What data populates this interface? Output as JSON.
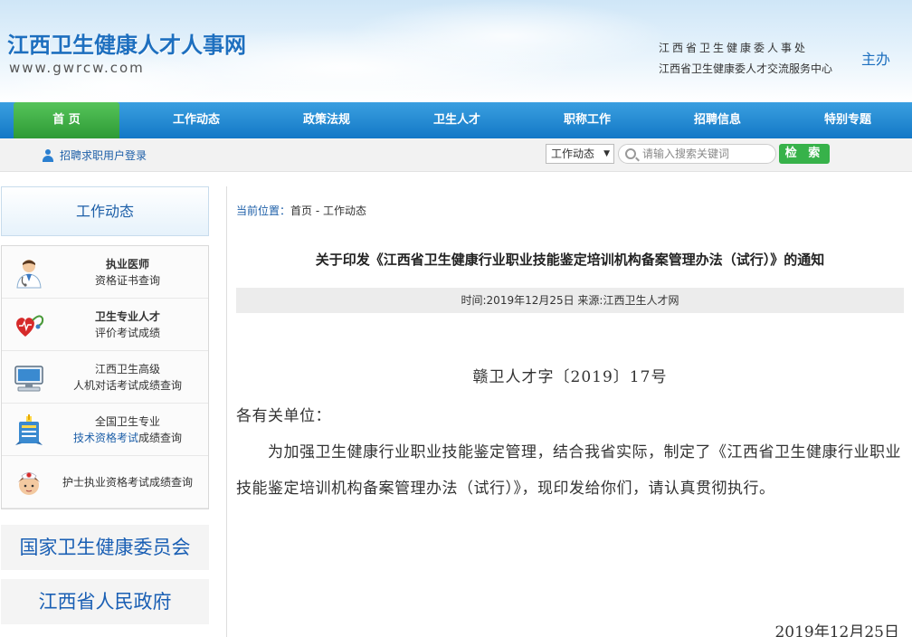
{
  "header": {
    "site_title": "江西卫生健康人才人事网",
    "site_url": "www.gwrcw.com",
    "sponsor_line1": "江西省卫生健康委人事处",
    "sponsor_line2": "江西省卫生健康委人才交流服务中心",
    "sponsor_label": "主办"
  },
  "nav": {
    "items": [
      {
        "label": "首 页",
        "active": true
      },
      {
        "label": "工作动态"
      },
      {
        "label": "政策法规"
      },
      {
        "label": "卫生人才"
      },
      {
        "label": "职称工作"
      },
      {
        "label": "招聘信息"
      },
      {
        "label": "特别专题"
      }
    ]
  },
  "subbar": {
    "login_label": "招聘求职用户登录",
    "select_value": "工作动态",
    "search_placeholder": "请输入搜索关键词",
    "search_button": "检 索"
  },
  "sidebar": {
    "heading": "工作动态",
    "items": [
      {
        "line1": "执业医师",
        "line2": "资格证书查询",
        "icon": "doctor-icon"
      },
      {
        "line1": "卫生专业人才",
        "line2": "评价考试成绩",
        "icon": "heart-stethoscope-icon"
      },
      {
        "line1": "江西卫生高级",
        "line2": "人机对话考试成绩查询",
        "icon": "computer-icon"
      },
      {
        "line1": "全国卫生专业",
        "line2a": "技术资格考试",
        "line2b": "成绩查询",
        "icon": "certificate-icon"
      },
      {
        "line1": "护士执业资格考试成绩查询",
        "icon": "nurse-icon"
      }
    ],
    "links": [
      "国家卫生健康委员会",
      "江西省人民政府"
    ]
  },
  "main": {
    "crumb_label": "当前位置：",
    "crumb_path": "首页 - 工作动态",
    "title": "关于印发《江西省卫生健康行业职业技能鉴定培训机构备案管理办法（试行）》的通知",
    "meta": "时间:2019年12月25日 来源:江西卫生人才网",
    "doc_no": "赣卫人才字〔2019〕17号",
    "greeting": "各有关单位：",
    "paragraph": "为加强卫生健康行业职业技能鉴定管理，结合我省实际，制定了《江西省卫生健康行业职业技能鉴定培训机构备案管理办法（试行）》，现印发给你们，请认真贯彻执行。",
    "date": "2019年12月25日"
  }
}
